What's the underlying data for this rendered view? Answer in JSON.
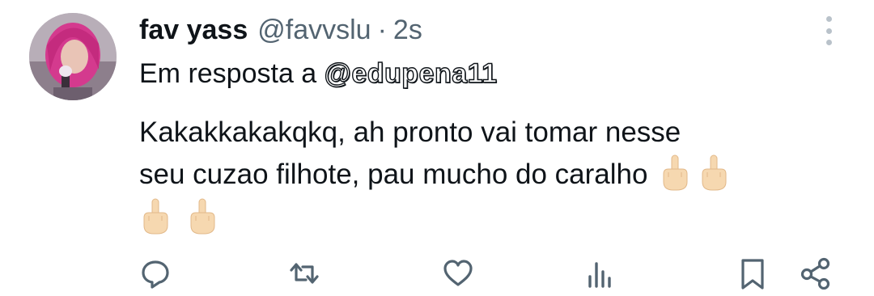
{
  "tweet": {
    "display_name": "fav yass",
    "handle": "@favvslu",
    "separator": "·",
    "timestamp": "2s",
    "reply_prefix": "Em resposta a",
    "reply_mention": "@edupena11",
    "text_line1": "Kakakkakakqkq, ah pronto vai tomar nesse",
    "text_line2": "seu cuzao filhote, pau mucho do caralho"
  },
  "icons": {
    "more": "more-vertical-icon",
    "reply": "reply-icon",
    "retweet": "retweet-icon",
    "like": "heart-icon",
    "views": "views-icon",
    "bookmark": "bookmark-icon",
    "share": "share-icon",
    "emoji": "middle-finger-emoji"
  },
  "colors": {
    "text": "#0f1419",
    "secondary": "#536471",
    "icon": "#536471",
    "emoji_skin": "#f6d8b0"
  }
}
